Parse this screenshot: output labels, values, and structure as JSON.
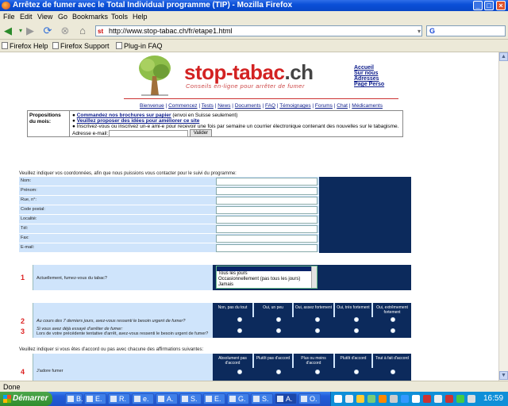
{
  "window": {
    "title": "Arrêtez de fumer avec le Total Individual programme (TIP) - Mozilla Firefox"
  },
  "menu": [
    "File",
    "Edit",
    "View",
    "Go",
    "Bookmarks",
    "Tools",
    "Help"
  ],
  "nav": {
    "url": "http://www.stop-tabac.ch/fr/etape1.html",
    "search_value": ""
  },
  "bookmarks": [
    "Firefox Help",
    "Firefox Support",
    "Plug-in FAQ"
  ],
  "page": {
    "brand": {
      "name": "stop-tabac",
      "tld": ".ch",
      "tagline": "Conseils en-ligne pour arrêter de fumer"
    },
    "top_links": [
      "Accueil",
      "Sur nous",
      "Adresses",
      "Page Perso"
    ],
    "site_nav": [
      "Bienvenue",
      "Commencez",
      "Tests",
      "News",
      "Documents",
      "FAQ",
      "Témoignages",
      "Forums",
      "Chat",
      "Médicaments"
    ],
    "propositions": {
      "label": "Propositions du mois:",
      "item1_link": "Commandez nos brochures sur papier",
      "item1_note": "(envoi en Suisse seulement)",
      "item2_link": "Veuillez proposer des idées pour améliorer ce site",
      "item3": "Inscrivez-vous ou inscrivez un-e ami-e pour recevoir une fois par semaine un courrier électronique contenant des nouvelles sur le tabagisme.",
      "email_label": "Adresse e-mail:",
      "submit": "Valider"
    },
    "contact_intro": "Veuillez indiquer vos coordonnées, afin que nous puissions vous contacter pour le suivi du programme:",
    "contact_fields": [
      "Nom:",
      "Prénom:",
      "Rue, n°:",
      "Code postal:",
      "Localité:",
      "Tél:",
      "Fax:",
      "E-mail:"
    ],
    "q1": {
      "number": "1",
      "text": "Actuellement, fumez-vous du tabac?",
      "options": [
        "",
        "Tous les jours",
        "Occasionnellement (pas tous les jours)",
        "Jamais"
      ]
    },
    "craving_headers": [
      "Non, pas du tout",
      "Oui, un peu",
      "Oui, assez fortement",
      "Oui, très fortement",
      "Oui, extrêmement fortement"
    ],
    "q2": {
      "number": "2",
      "text": "Au cours des 7 derniers jours, avez-vous ressenti le besoin urgent de fumer?"
    },
    "q3": {
      "number": "3",
      "line1": "Si vous avez déjà essayé d'arrêter de fumer:",
      "line2": "Lors de votre précédente tentative d'arrêt, avez-vous ressenti le besoin urgent de fumer?"
    },
    "agree_intro": "Veuillez indiquer si vous êtes d'accord ou pas avec chacune des affirmations suivantes:",
    "agree_headers": [
      "Absolument pas d'accord",
      "Plutôt pas d'accord",
      "Plus ou moins d'accord",
      "Plutôt d'accord",
      "Tout à fait d'accord"
    ],
    "q4": {
      "number": "4",
      "text": "J'adore fumer"
    }
  },
  "status": "Done",
  "taskbar": {
    "start": "Démarrer",
    "tasks": [
      "B.",
      "E.",
      "R.",
      "e.",
      "A.",
      "S.",
      "E.",
      "G.",
      "S.",
      "A.",
      "O."
    ],
    "clock": "16:59"
  }
}
